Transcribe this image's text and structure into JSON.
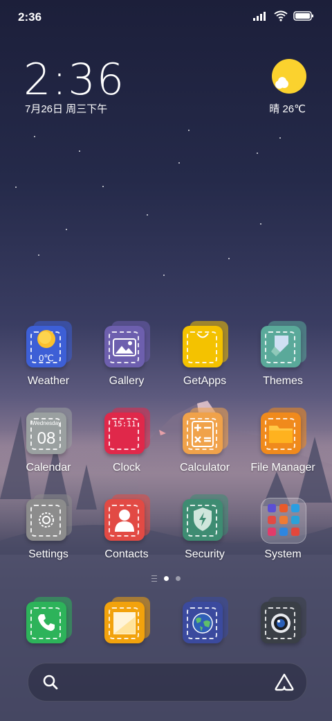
{
  "status_bar": {
    "time": "2:36"
  },
  "clock_widget": {
    "time": "2:36",
    "date": "7月26日 周三下午"
  },
  "weather_widget": {
    "condition_temp": "晴 26℃"
  },
  "home_grid": {
    "weather": {
      "label": "Weather",
      "icon_text": "0℃"
    },
    "gallery": {
      "label": "Gallery"
    },
    "getapps": {
      "label": "GetApps"
    },
    "themes": {
      "label": "Themes"
    },
    "calendar": {
      "label": "Calendar",
      "weekday": "Wednesday",
      "day": "08"
    },
    "clock": {
      "label": "Clock",
      "icon_text": "15:11"
    },
    "calculator": {
      "label": "Calculator"
    },
    "file_manager": {
      "label": "File Manager"
    },
    "settings": {
      "label": "Settings"
    },
    "contacts": {
      "label": "Contacts"
    },
    "security": {
      "label": "Security"
    },
    "system": {
      "label": "System"
    }
  },
  "colors": {
    "weather": "#3d5fd6",
    "gallery": "#6d5fae",
    "getapps": "#f4c200",
    "themes": "#5aa99a",
    "calendar": "#9aa0a0",
    "clock": "#e0284a",
    "calculator": "#f0a24a",
    "file_manager": "#f08a1c",
    "settings": "#8c8c8c",
    "contacts": "#e24a44",
    "security": "#3e8c72",
    "phone": "#2db35a",
    "notes": "#f2a20c",
    "browser": "#3b4a9e",
    "camera": "#3a3f46"
  }
}
